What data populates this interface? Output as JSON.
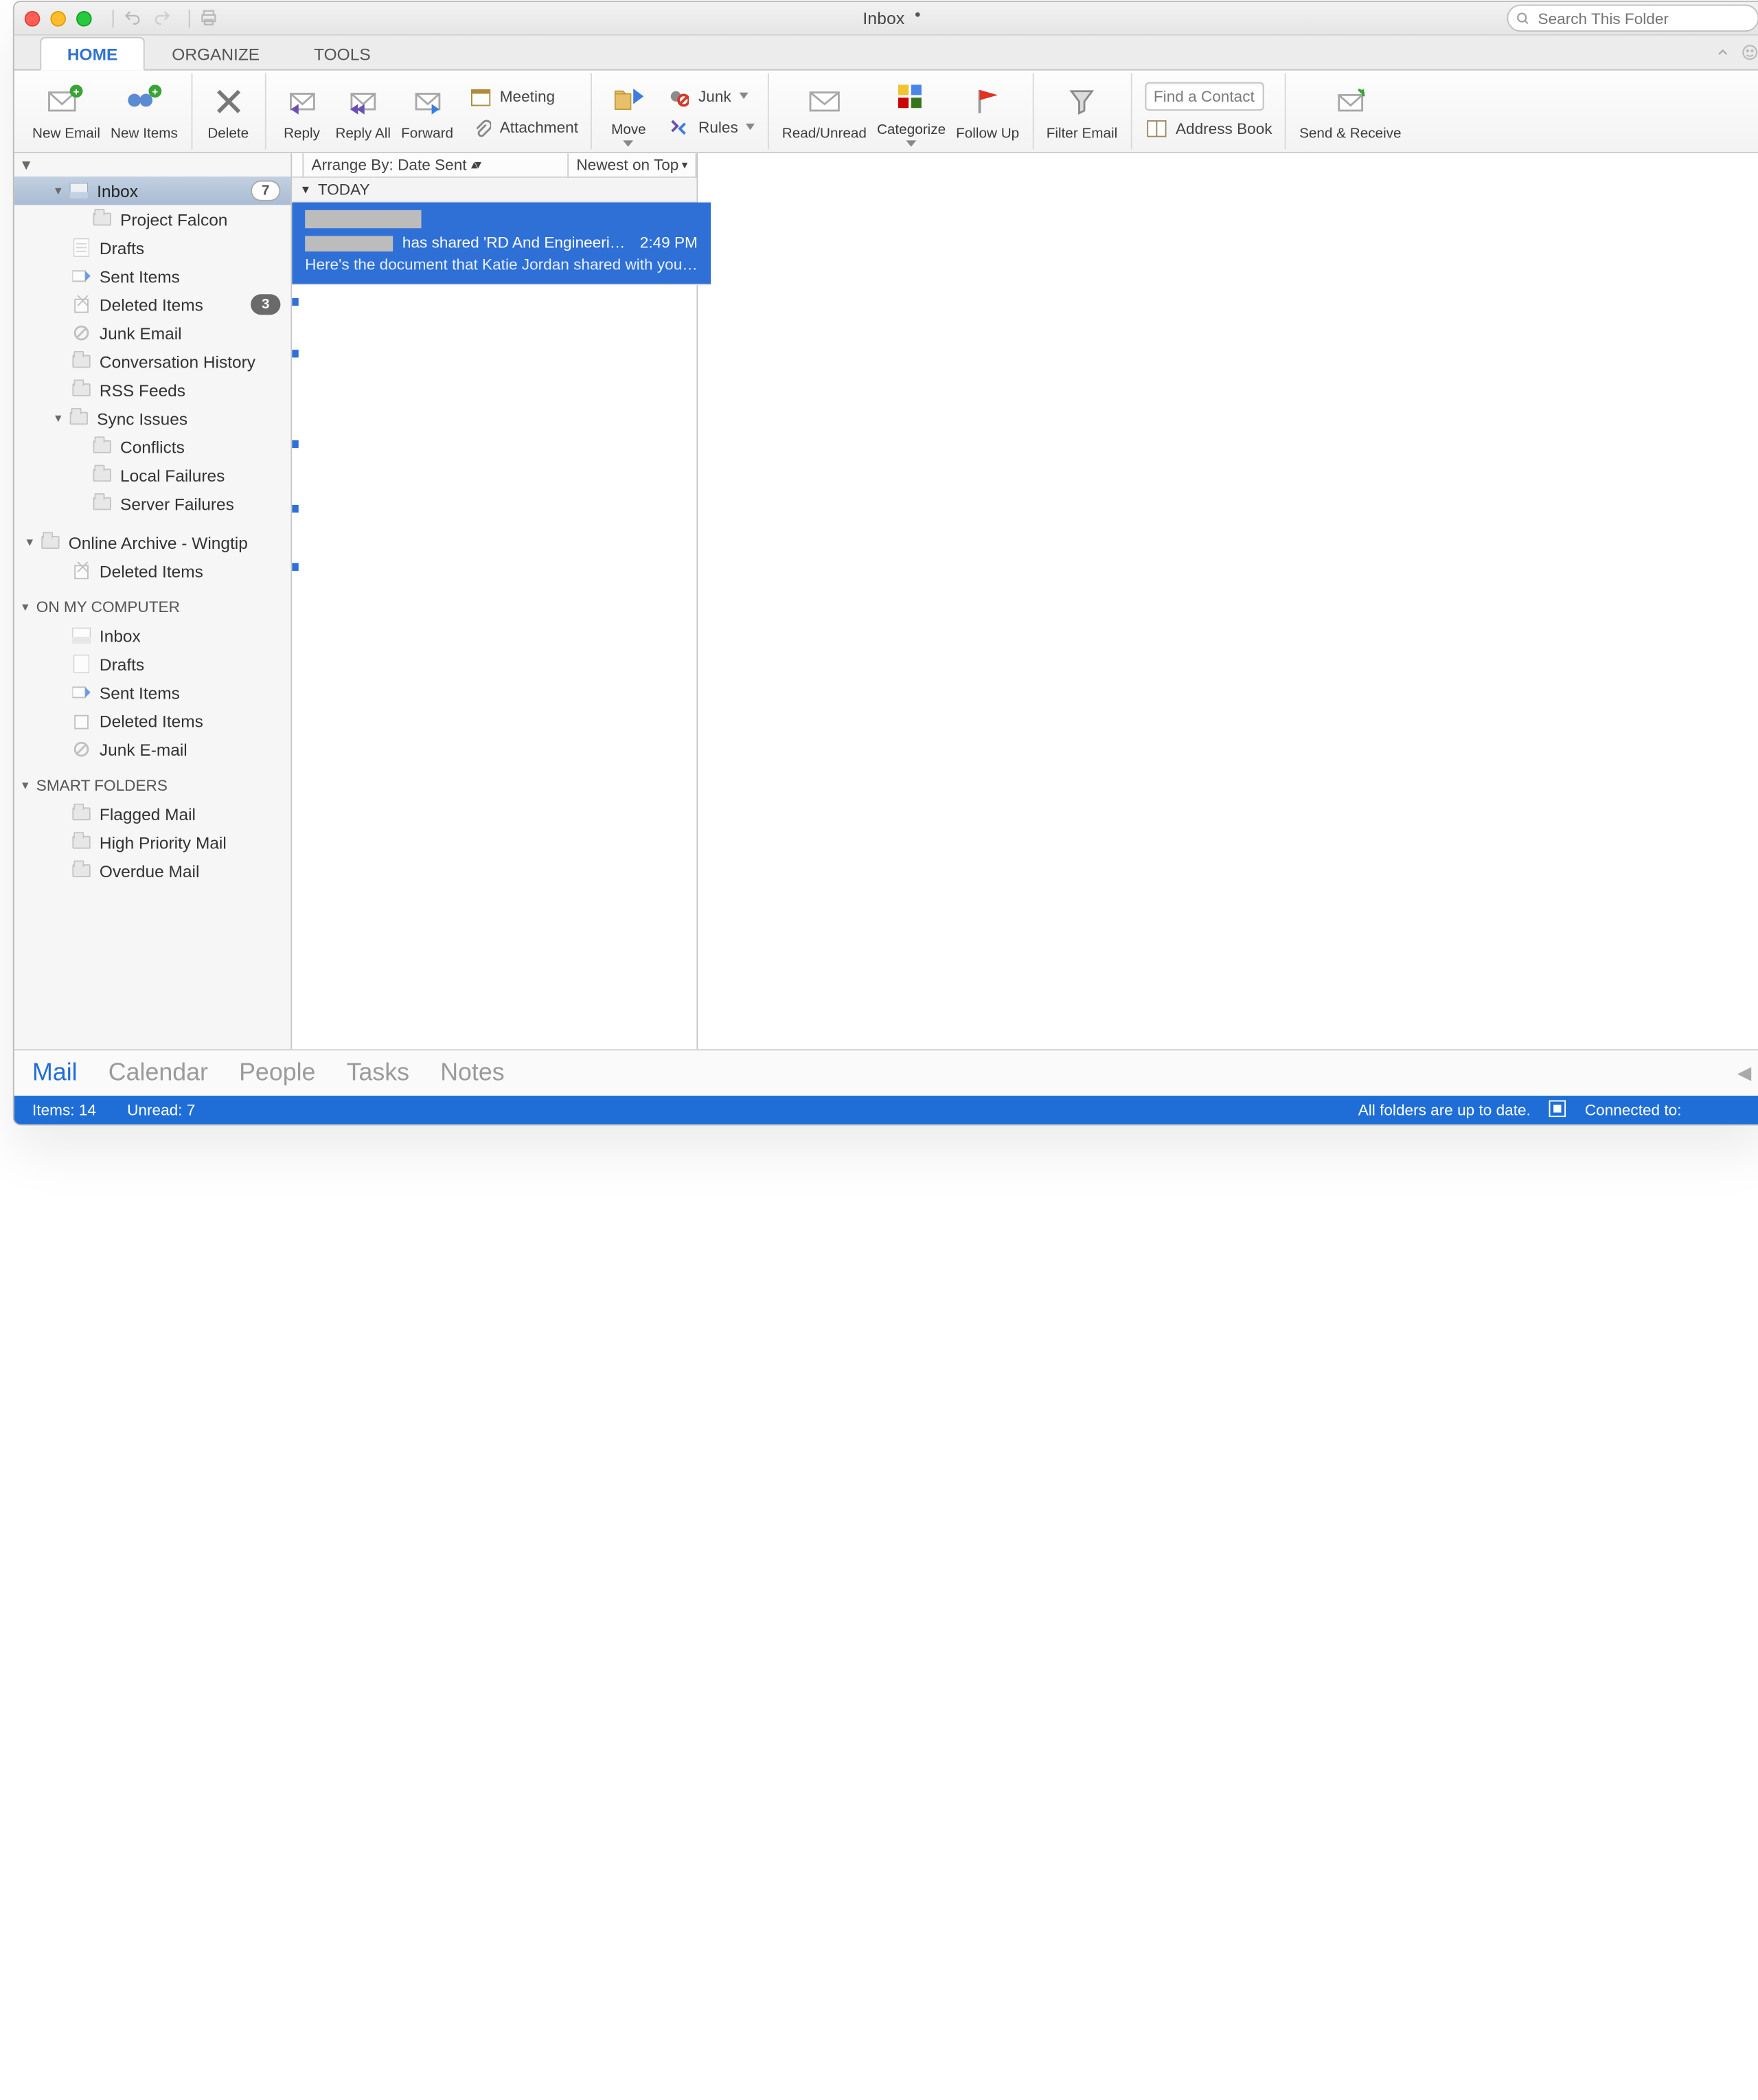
{
  "window": {
    "title": "Inbox",
    "dirty_indicator": "•"
  },
  "search": {
    "placeholder": "Search This Folder"
  },
  "tabs": {
    "home": "HOME",
    "organize": "ORGANIZE",
    "tools": "TOOLS"
  },
  "ribbon": {
    "new_email": "New Email",
    "new_items": "New Items",
    "delete": "Delete",
    "reply": "Reply",
    "reply_all": "Reply All",
    "forward": "Forward",
    "meeting": "Meeting",
    "attachment": "Attachment",
    "move": "Move",
    "junk": "Junk",
    "rules": "Rules",
    "read_unread": "Read/Unread",
    "categorize": "Categorize",
    "follow_up": "Follow Up",
    "filter_email": "Filter Email",
    "find_contact": "Find a Contact",
    "address_book": "Address Book",
    "send_receive": "Send & Receive"
  },
  "sidebar": {
    "account1": {
      "inbox": "Inbox",
      "inbox_count": "7",
      "project_falcon": "Project Falcon",
      "drafts": "Drafts",
      "sent": "Sent Items",
      "deleted": "Deleted Items",
      "deleted_count": "3",
      "junk": "Junk Email",
      "conv": "Conversation History",
      "rss": "RSS Feeds",
      "sync": "Sync Issues",
      "conflicts": "Conflicts",
      "local_fail": "Local Failures",
      "server_fail": "Server Failures"
    },
    "archive": {
      "header": "Online Archive - Wingtip",
      "deleted": "Deleted Items"
    },
    "on_my_computer": {
      "header": "ON MY COMPUTER",
      "inbox": "Inbox",
      "drafts": "Drafts",
      "sent": "Sent Items",
      "deleted": "Deleted Items",
      "junk": "Junk E-mail"
    },
    "smart": {
      "header": "SMART FOLDERS",
      "flagged": "Flagged Mail",
      "high": "High Priority Mail",
      "overdue": "Overdue Mail"
    }
  },
  "mlist": {
    "arrange_label": "Arrange By: Date Sent",
    "sort_label": "Newest on Top",
    "section_today": "TODAY",
    "selected": {
      "subject": " has shared 'RD And Engineeri…",
      "time": "2:49 PM",
      "preview": "Here's the document that Katie Jordan shared with you…"
    }
  },
  "nav": {
    "mail": "Mail",
    "calendar": "Calendar",
    "people": "People",
    "tasks": "Tasks",
    "notes": "Notes"
  },
  "status": {
    "items": "Items: 14",
    "unread": "Unread: 7",
    "sync": "All folders are up to date.",
    "connected": "Connected to:"
  }
}
